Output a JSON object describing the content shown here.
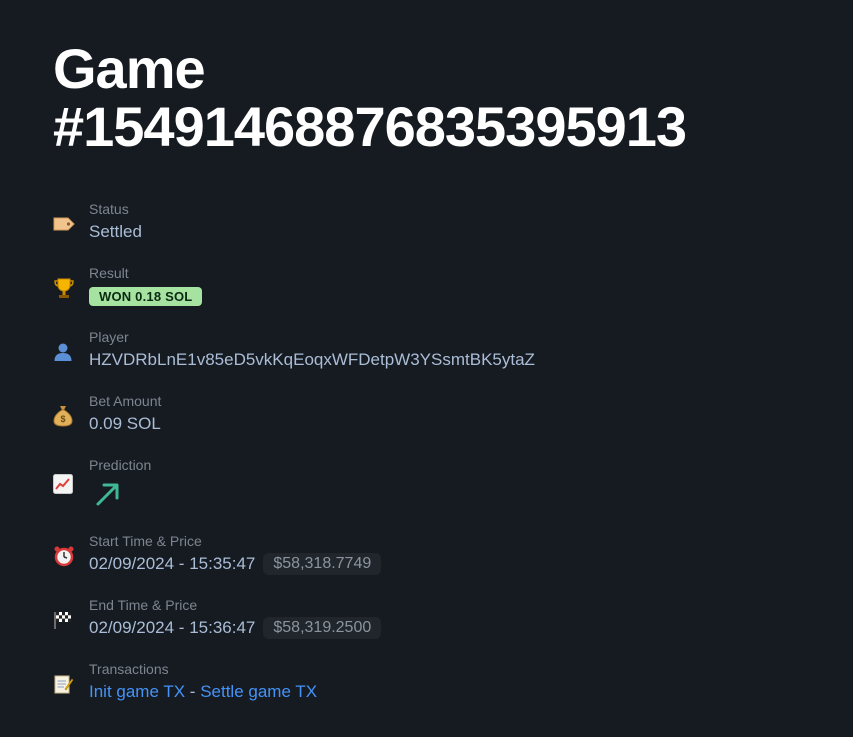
{
  "game": {
    "title_line1": "Game",
    "title_line2": "#154914688768353959 13"
  },
  "fields": {
    "status": {
      "label": "Status",
      "value": "Settled",
      "icon": "tag-icon"
    },
    "result": {
      "label": "Result",
      "badge": "WON 0.18 SOL",
      "badge_color": "#a6e3a1",
      "icon": "trophy-icon"
    },
    "player": {
      "label": "Player",
      "value": "HZVDRbLnE1v85eD5vkKqEoqxWFDetpW3YSsmtBK5ytaZ",
      "icon": "user-icon"
    },
    "bet_amount": {
      "label": "Bet Amount",
      "value": "0.09 SOL",
      "icon": "money-bag-icon"
    },
    "prediction": {
      "label": "Prediction",
      "direction": "up",
      "arrow_color": "#3fb994",
      "icon": "chart-up-icon"
    },
    "start": {
      "label": "Start Time & Price",
      "time": "02/09/2024 - 15:35:47",
      "price": "$58,318.7749",
      "icon": "alarm-clock-icon"
    },
    "end": {
      "label": "End Time & Price",
      "time": "02/09/2024 - 15:36:47",
      "price": "$58,319.2500",
      "icon": "checkered-flag-icon"
    },
    "transactions": {
      "label": "Transactions",
      "init_link": "Init game TX",
      "separator": " - ",
      "settle_link": "Settle game TX",
      "icon": "memo-icon"
    }
  }
}
